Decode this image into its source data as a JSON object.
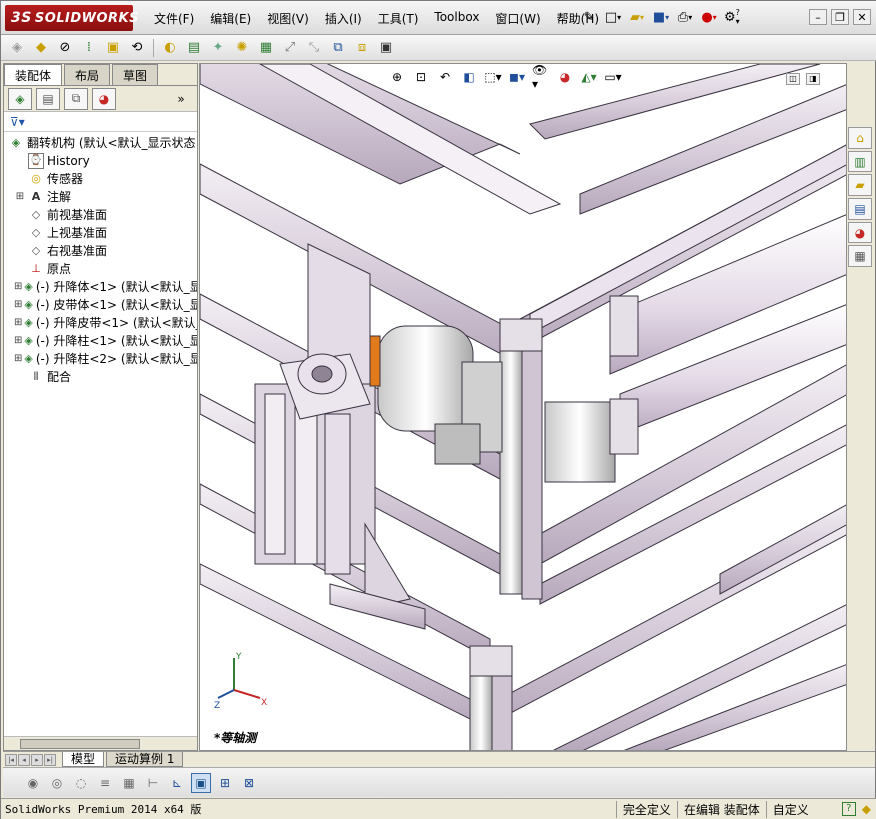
{
  "app": {
    "brand": "SOLIDWORKS",
    "brand_prefix": "3S"
  },
  "menu": [
    "文件(F)",
    "编辑(E)",
    "视图(V)",
    "插入(I)",
    "工具(T)",
    "Toolbox",
    "窗口(W)",
    "帮助(H)"
  ],
  "left_panel": {
    "tabs": [
      "装配体",
      "布局",
      "草图"
    ],
    "active_tab": "装配体",
    "root_label": "翻转机构 (默认<默认_显示状态",
    "items": [
      {
        "label": "History",
        "icon": "history-icon",
        "expandable": false
      },
      {
        "label": "传感器",
        "icon": "sensor-icon",
        "expandable": false
      },
      {
        "label": "注解",
        "icon": "annotation-icon",
        "expandable": true
      },
      {
        "label": "前视基准面",
        "icon": "plane-icon",
        "expandable": false
      },
      {
        "label": "上视基准面",
        "icon": "plane-icon",
        "expandable": false
      },
      {
        "label": "右视基准面",
        "icon": "plane-icon",
        "expandable": false
      },
      {
        "label": "原点",
        "icon": "origin-icon",
        "expandable": false
      },
      {
        "label": "(-) 升降体<1> (默认<默认_显",
        "icon": "part-icon",
        "expandable": true
      },
      {
        "label": "(-) 皮带体<1> (默认<默认_显",
        "icon": "part-icon",
        "expandable": true
      },
      {
        "label": "(-) 升降皮带<1> (默认<默认_显",
        "icon": "part-icon",
        "expandable": true
      },
      {
        "label": "(-) 升降柱<1> (默认<默认_显",
        "icon": "part-icon",
        "expandable": true
      },
      {
        "label": "(-) 升降柱<2> (默认<默认_显",
        "icon": "part-icon",
        "expandable": true
      },
      {
        "label": "配合",
        "icon": "mates-icon",
        "expandable": false
      }
    ]
  },
  "viewport": {
    "view_name": "*等轴测",
    "triad_axes": [
      "Y",
      "X",
      "Z"
    ]
  },
  "bottom_tabs": [
    "模型",
    "运动算例 1"
  ],
  "active_bottom_tab": "模型",
  "status": {
    "version": "SolidWorks Premium 2014 x64 版",
    "definition": "完全定义",
    "editing": "在编辑 装配体",
    "units": "自定义"
  }
}
